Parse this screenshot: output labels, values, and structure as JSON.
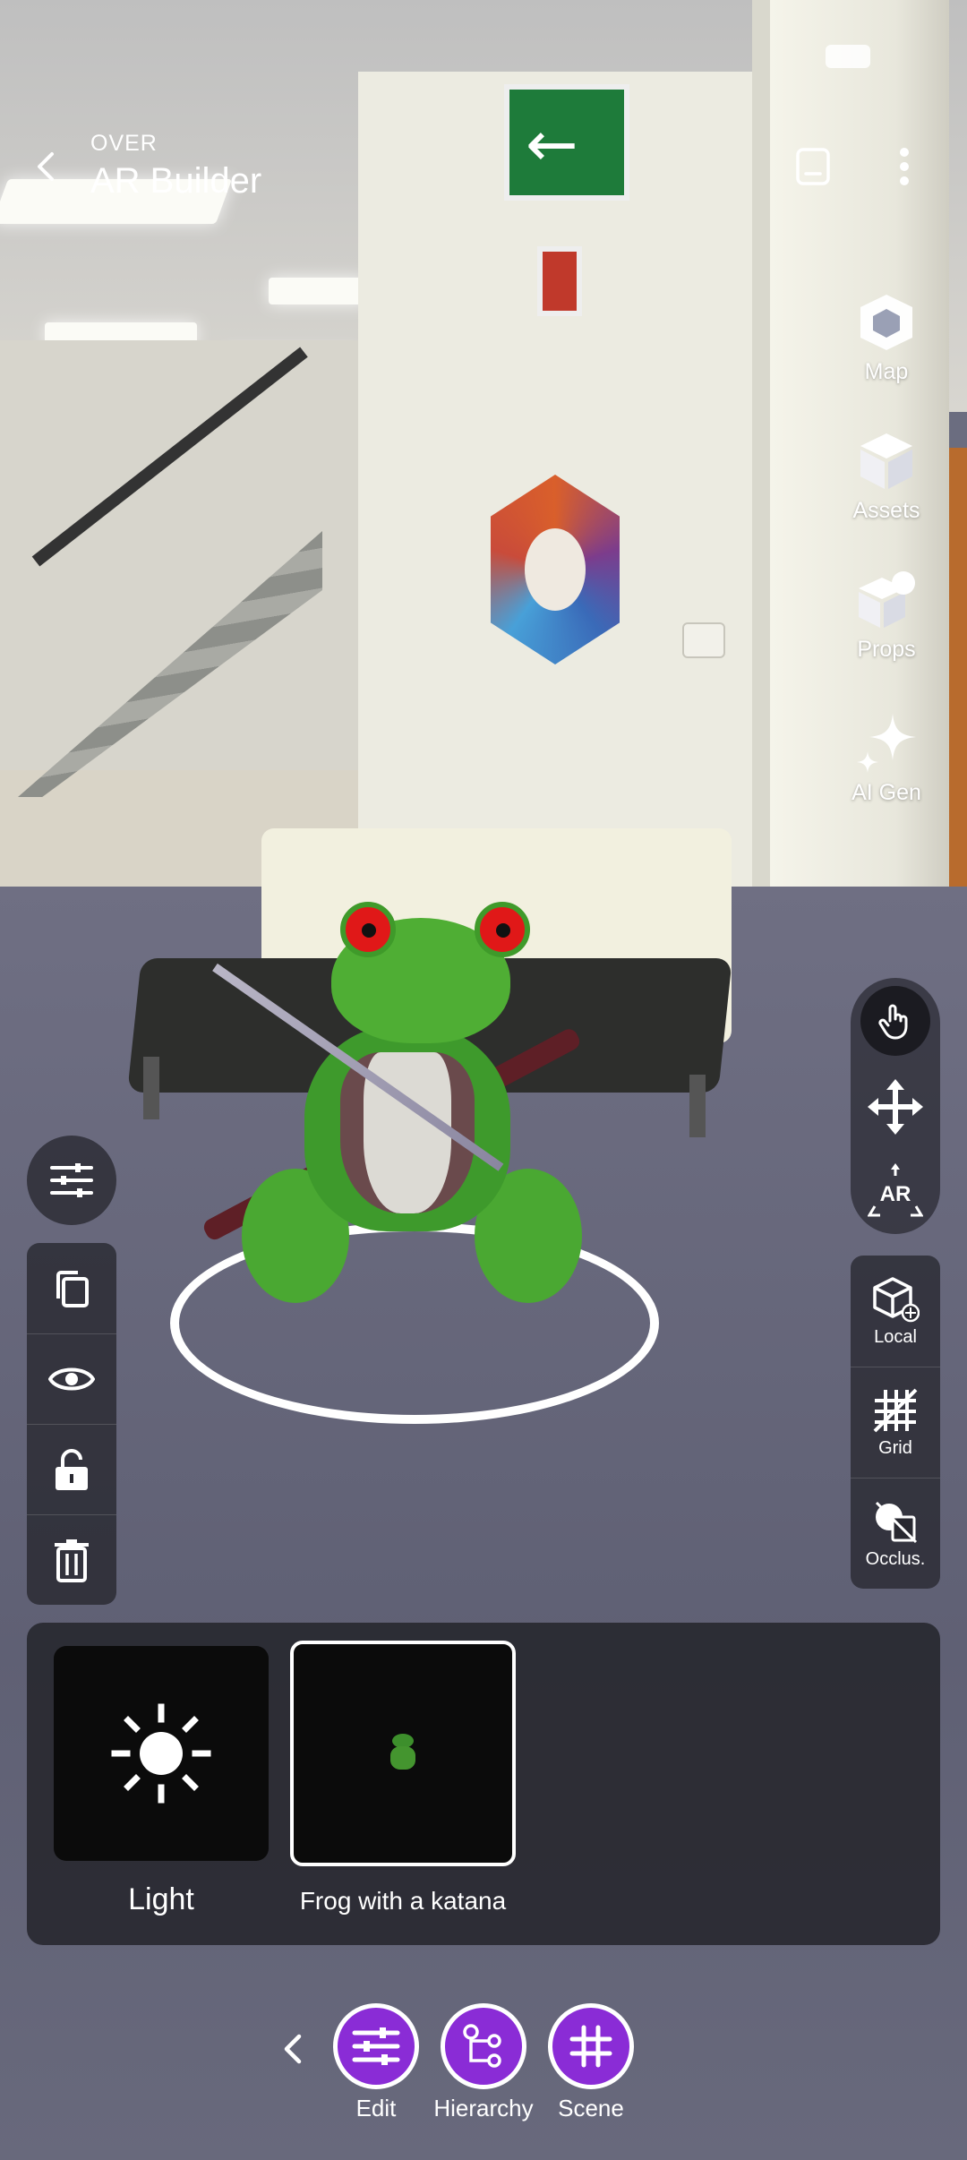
{
  "header": {
    "overline": "OVER",
    "title": "AR Builder"
  },
  "right_tools": [
    {
      "label": "Map",
      "icon": "map-icon"
    },
    {
      "label": "Assets",
      "icon": "cube-icon"
    },
    {
      "label": "Props",
      "icon": "props-icon"
    },
    {
      "label": "AI Gen",
      "icon": "sparkle-icon"
    }
  ],
  "manipulate": {
    "hand_icon": "hand-pointer-icon",
    "move_icon": "move-arrows-icon",
    "ar_label": "AR"
  },
  "view_toggles": [
    {
      "label": "Local",
      "icon": "local-cube-icon"
    },
    {
      "label": "Grid",
      "icon": "grid-icon"
    },
    {
      "label": "Occlus.",
      "icon": "occlusion-icon"
    }
  ],
  "left_tools": [
    "sliders-icon",
    "duplicate-icon",
    "eye-icon",
    "unlock-icon",
    "trash-icon"
  ],
  "hierarchy": {
    "items": [
      {
        "label": "Light",
        "icon": "sun-icon",
        "selected": false
      },
      {
        "label": "Frog with a katana",
        "icon": "frog-thumbnail",
        "selected": true
      }
    ]
  },
  "bottom_nav": {
    "items": [
      {
        "label": "Edit",
        "icon": "sliders-icon"
      },
      {
        "label": "Hierarchy",
        "icon": "tree-icon"
      },
      {
        "label": "Scene",
        "icon": "hash-grid-icon"
      }
    ],
    "accent": "#8a2cd6"
  }
}
